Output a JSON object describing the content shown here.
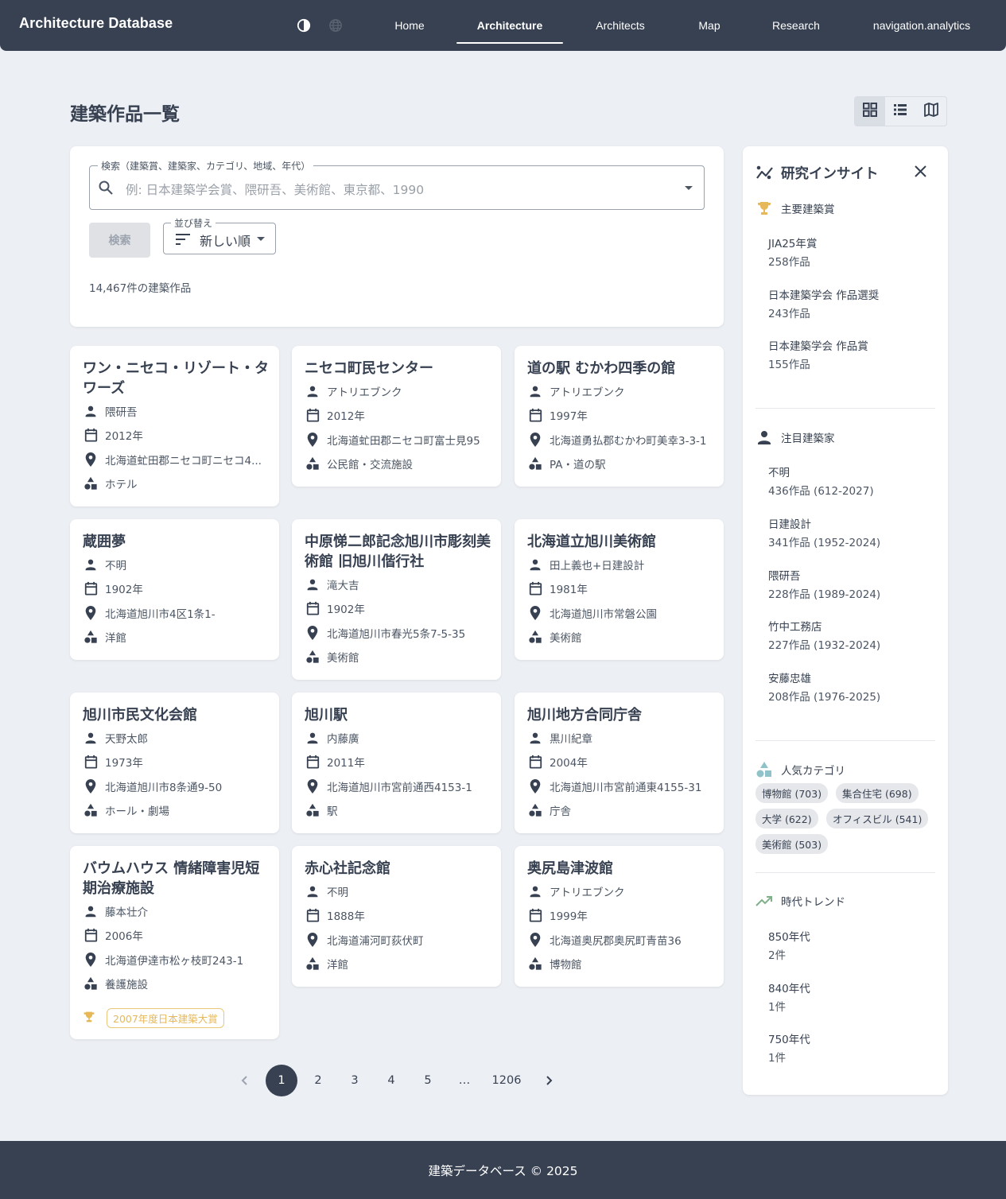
{
  "header": {
    "brand": "Architecture Database",
    "nav": [
      {
        "label": "Home"
      },
      {
        "label": "Architecture"
      },
      {
        "label": "Architects"
      },
      {
        "label": "Map"
      },
      {
        "label": "Research"
      },
      {
        "label": "navigation.analytics"
      }
    ],
    "active_nav": "Architecture",
    "icons": [
      "theme-toggle-icon",
      "language-globe-icon"
    ]
  },
  "page": {
    "title": "建築作品一覧",
    "view_modes": [
      "grid",
      "list",
      "map"
    ],
    "active_view": "grid"
  },
  "search": {
    "label": "検索（建築賞、建築家、カテゴリ、地域、年代）",
    "placeholder": "例: 日本建築学会賞、隈研吾、美術館、東京都、1990",
    "button_label": "検索",
    "sort_label": "並び替え",
    "sort_value": "新しい順",
    "result_count": "14,467件の建築作品"
  },
  "cards": [
    {
      "title": "ワン・ニセコ・リゾート・タワーズ",
      "architect": "隈研吾",
      "year": "2012年",
      "address": "北海道虻田郡ニセコ町ニセコ4...",
      "category": "ホテル"
    },
    {
      "title": "ニセコ町民センター",
      "architect": "アトリエブンク",
      "year": "2012年",
      "address": "北海道虻田郡ニセコ町富士見95",
      "category": "公民館・交流施設"
    },
    {
      "title": "道の駅 むかわ四季の館",
      "architect": "アトリエブンク",
      "year": "1997年",
      "address": "北海道勇払郡むかわ町美幸3-3-1",
      "category": "PA・道の駅"
    },
    {
      "title": "蔵囲夢",
      "architect": "不明",
      "year": "1902年",
      "address": "北海道旭川市4区1条1-",
      "category": "洋館"
    },
    {
      "title": "中原悌二郎記念旭川市彫刻美術館 旧旭川偕行社",
      "architect": "滝大吉",
      "year": "1902年",
      "address": "北海道旭川市春光5条7-5-35",
      "category": "美術館"
    },
    {
      "title": "北海道立旭川美術館",
      "architect": "田上義也+日建設計",
      "year": "1981年",
      "address": "北海道旭川市常磐公園",
      "category": "美術館"
    },
    {
      "title": "旭川市民文化会館",
      "architect": "天野太郎",
      "year": "1973年",
      "address": "北海道旭川市8条通9-50",
      "category": "ホール・劇場"
    },
    {
      "title": "旭川駅",
      "architect": "内藤廣",
      "year": "2011年",
      "address": "北海道旭川市宮前通西4153-1",
      "category": "駅"
    },
    {
      "title": "旭川地方合同庁舎",
      "architect": "黒川紀章",
      "year": "2004年",
      "address": "北海道旭川市宮前通東4155-31",
      "category": "庁舎"
    },
    {
      "title": "バウムハウス 情緒障害児短期治療施設",
      "architect": "藤本壮介",
      "year": "2006年",
      "address": "北海道伊達市松ヶ枝町243-1",
      "category": "養護施設",
      "award": "2007年度日本建築大賞"
    },
    {
      "title": "赤心社記念館",
      "architect": "不明",
      "year": "1888年",
      "address": "北海道浦河町荻伏町",
      "category": "洋館"
    },
    {
      "title": "奥尻島津波館",
      "architect": "アトリエブンク",
      "year": "1999年",
      "address": "北海道奥尻郡奥尻町青苗36",
      "category": "博物館"
    }
  ],
  "pagination": {
    "pages": [
      "1",
      "2",
      "3",
      "4",
      "5",
      "…",
      "1206"
    ],
    "current": "1"
  },
  "insights": {
    "title": "研究インサイト",
    "awards": {
      "heading": "主要建築賞",
      "items": [
        {
          "name": "JIA25年賞",
          "count": "258作品"
        },
        {
          "name": "日本建築学会 作品選奨",
          "count": "243作品"
        },
        {
          "name": "日本建築学会 作品賞",
          "count": "155作品"
        }
      ]
    },
    "architects": {
      "heading": "注目建築家",
      "items": [
        {
          "name": "不明",
          "count": "436作品 (612-2027)"
        },
        {
          "name": "日建設計",
          "count": "341作品 (1952-2024)"
        },
        {
          "name": "隈研吾",
          "count": "228作品 (1989-2024)"
        },
        {
          "name": "竹中工務店",
          "count": "227作品 (1932-2024)"
        },
        {
          "name": "安藤忠雄",
          "count": "208作品 (1976-2025)"
        }
      ]
    },
    "categories": {
      "heading": "人気カテゴリ",
      "chips": [
        "博物館 (703)",
        "集合住宅 (698)",
        "大学 (622)",
        "オフィスビル (541)",
        "美術館 (503)"
      ]
    },
    "trends": {
      "heading": "時代トレンド",
      "items": [
        {
          "name": "850年代",
          "count": "2件"
        },
        {
          "name": "840年代",
          "count": "1件"
        },
        {
          "name": "750年代",
          "count": "1件"
        }
      ]
    }
  },
  "footer": {
    "text": "建築データベース © 2025"
  },
  "colors": {
    "header_bg": "#374151",
    "page_bg": "#eceff3",
    "award_gold": "#e6b85a",
    "category_teal": "#8fc3c9",
    "trend_green": "#7fb08a"
  }
}
